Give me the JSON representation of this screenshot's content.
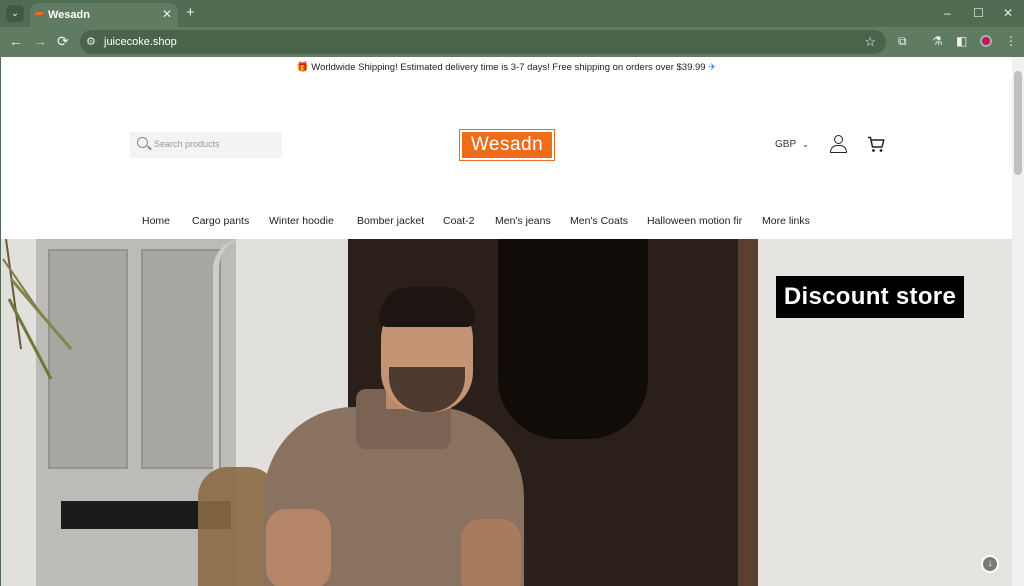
{
  "browser": {
    "tab_title": "Wesadn",
    "tab_close": "✕",
    "new_tab": "+",
    "url": "juicecoke.shop",
    "window_controls": {
      "minimize": "–",
      "maximize": "☐",
      "close": "✕"
    },
    "nav": {
      "back": "←",
      "forward": "→",
      "reload": "⟳"
    },
    "icons": [
      "tab-menu-icon",
      "site-settings-icon",
      "bookmark-star-icon",
      "extensions-icon",
      "labs-icon",
      "side-panel-icon",
      "profile-icon",
      "kebab-menu-icon"
    ]
  },
  "announcement": {
    "gift": "🎁",
    "text": "Worldwide Shipping! Estimated delivery time is 3-7 days! Free shipping on orders over $39.99",
    "plane": "✈"
  },
  "header": {
    "search_placeholder": "Search products",
    "logo": "Wesadn",
    "currency": "GBP",
    "brand_color": "#ef6c1a"
  },
  "nav": {
    "items": [
      "Home",
      "Cargo pants",
      "Winter hoodie",
      "Bomber jacket",
      "Coat-2",
      "Men's jeans",
      "Men's Coats",
      "Halloween motion fir",
      "More links"
    ]
  },
  "hero": {
    "badge": "Discount store"
  }
}
